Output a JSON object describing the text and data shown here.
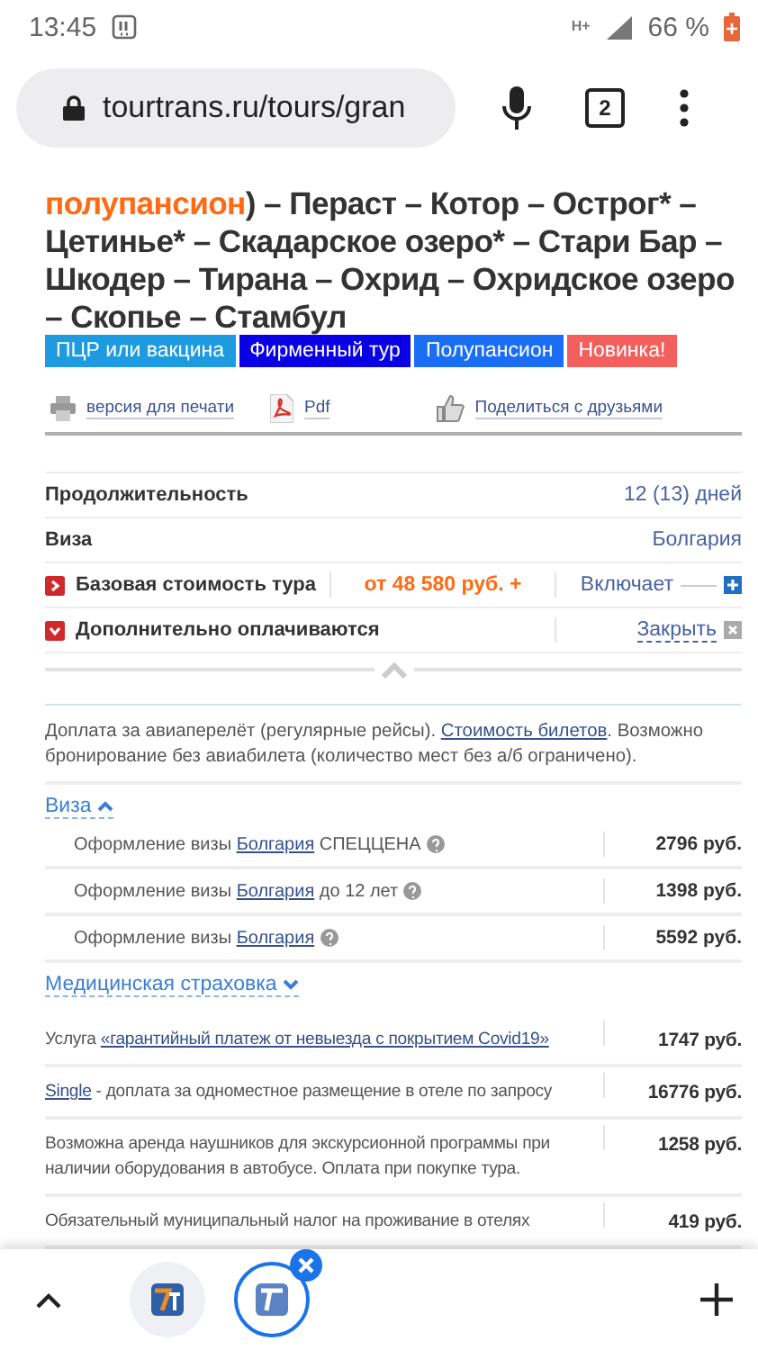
{
  "status_bar": {
    "time": "13:45",
    "network": "H+",
    "battery": "66 %"
  },
  "browser": {
    "url": "tourtrans.ru/tours/gran",
    "tab_count": "2"
  },
  "title": [
    {
      "text": "полупансион",
      "kind": "highlight"
    },
    {
      "text": ") – Пераст – Котор – Острог* – Цетинье* – Скадарское озеро* – Стари Бар – Шкодер – Тирана – Охрид – Охридское озеро – Скопье – Стамбул",
      "kind": "plain"
    }
  ],
  "tags": [
    {
      "label": "ПЦР или вакцина",
      "color": "#1e9be0"
    },
    {
      "label": "Фирменный тур",
      "color": "#0a00e6"
    },
    {
      "label": "Полупансион",
      "color": "#1a6ef5"
    },
    {
      "label": "Новинка!",
      "color": "#f25f5c"
    }
  ],
  "actions": [
    {
      "label": "версия для печати",
      "kind": "print"
    },
    {
      "label": "Pdf",
      "kind": "pdf"
    },
    {
      "label": "Поделиться с друзьями",
      "kind": "share"
    }
  ],
  "info_rows": [
    {
      "kind": "plain",
      "label": "Продолжительность",
      "value": "12 (13) дней"
    },
    {
      "kind": "plain",
      "label": "Виза",
      "value": "Болгария"
    },
    {
      "kind": "toggle",
      "label": "Базовая стоимость тура",
      "price": "от 48 580 руб. +",
      "action": "Включает",
      "expanded": false
    },
    {
      "kind": "toggle",
      "label": "Дополнительно оплачиваются",
      "action": "Закрыть",
      "expanded": true
    }
  ],
  "note": [
    {
      "text": "Доплата за авиаперелёт (регулярные рейсы). ",
      "kind": "plain"
    },
    {
      "text": "Стоимость билетов",
      "kind": "link"
    },
    {
      "text": ". Возможно бронирование без авиабилета (количество мест без а/б ограничено).",
      "kind": "plain"
    }
  ],
  "groups": [
    {
      "title": "Виза",
      "expanded": true,
      "items": [
        {
          "parts": [
            {
              "text": "Оформление визы ",
              "kind": "plain"
            },
            {
              "text": "Болгария",
              "kind": "link"
            },
            {
              "text": " СПЕЦЦЕНА",
              "kind": "plain"
            }
          ],
          "help": true,
          "price": "2796 руб."
        },
        {
          "parts": [
            {
              "text": "Оформление визы ",
              "kind": "plain"
            },
            {
              "text": "Болгария",
              "kind": "link"
            },
            {
              "text": " до 12 лет",
              "kind": "plain"
            }
          ],
          "help": true,
          "price": "1398 руб."
        },
        {
          "parts": [
            {
              "text": "Оформление визы ",
              "kind": "plain"
            },
            {
              "text": "Болгария",
              "kind": "link"
            }
          ],
          "help": true,
          "price": "5592 руб."
        }
      ]
    },
    {
      "title": "Медицинская страховка",
      "expanded": false
    }
  ],
  "extras": [
    {
      "parts": [
        {
          "text": "Услуга ",
          "kind": "plain"
        },
        {
          "text": "«гарантийный платеж от невыезда с покрытием Covid19»",
          "kind": "link"
        }
      ],
      "price": "1747 руб."
    },
    {
      "parts": [
        {
          "text": "Single",
          "kind": "link"
        },
        {
          "text": " - доплата за одноместное размещение в отеле по запросу",
          "kind": "plain"
        }
      ],
      "price": "16776 руб."
    },
    {
      "parts": [
        {
          "text": "Возможна аренда наушников для экскурсионной программы при наличии оборудования в автобусе. Оплата при покупке тура.",
          "kind": "plain"
        }
      ],
      "price": "1258 руб."
    },
    {
      "parts": [
        {
          "text": "Обязательный муниципальный налог на проживание в отелях",
          "kind": "plain"
        }
      ],
      "price": "419 руб."
    }
  ],
  "tab_strip": [
    {
      "selected": false
    },
    {
      "selected": true
    }
  ]
}
